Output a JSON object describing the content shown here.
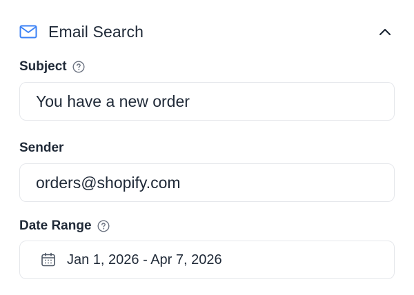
{
  "section": {
    "title": "Email Search",
    "icon": "mail-icon",
    "collapse_icon": "chevron-up-icon",
    "accent_color": "#3b82f6"
  },
  "fields": {
    "subject": {
      "label": "Subject",
      "value": "You have a new order",
      "help_icon": "help-circle-icon"
    },
    "sender": {
      "label": "Sender",
      "value": "orders@shopify.com"
    },
    "date_range": {
      "label": "Date Range",
      "value": "Jan 1, 2026 - Apr 7, 2026",
      "icon": "calendar-icon",
      "help_icon": "help-circle-icon"
    }
  }
}
